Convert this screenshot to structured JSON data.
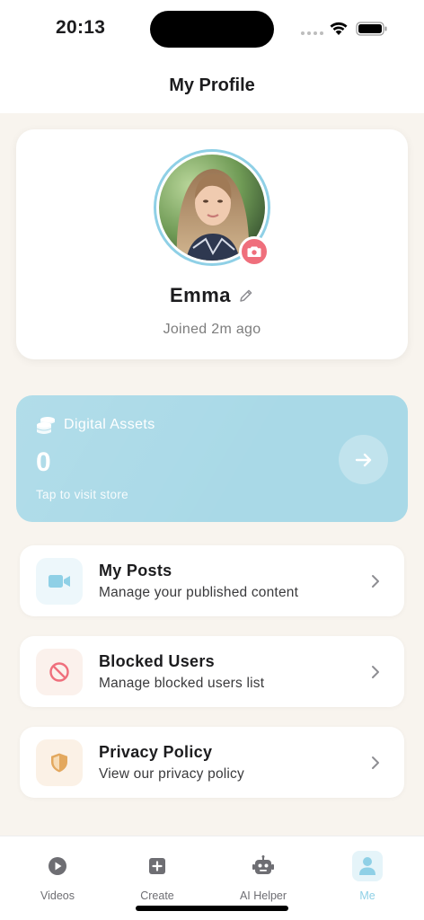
{
  "status_bar": {
    "time": "20:13"
  },
  "header": {
    "title": "My Profile"
  },
  "profile": {
    "name": "Emma",
    "joined": "Joined 2m ago"
  },
  "assets": {
    "title": "Digital Assets",
    "value": "0",
    "hint": "Tap to visit store"
  },
  "menu": [
    {
      "title": "My Posts",
      "subtitle": "Manage your published content",
      "icon": "video-icon"
    },
    {
      "title": "Blocked Users",
      "subtitle": "Manage blocked users list",
      "icon": "block-icon"
    },
    {
      "title": "Privacy Policy",
      "subtitle": "View our privacy policy",
      "icon": "shield-icon"
    }
  ],
  "tabs": [
    {
      "label": "Videos",
      "icon": "play-icon"
    },
    {
      "label": "Create",
      "icon": "plus-square-icon"
    },
    {
      "label": "AI Helper",
      "icon": "robot-icon"
    },
    {
      "label": "Me",
      "icon": "person-icon",
      "active": true
    }
  ],
  "colors": {
    "accent": "#8fd0e6",
    "assets_card": "#a9d9e7",
    "camera_badge": "#ef6f7c",
    "background": "#f8f4ee"
  }
}
